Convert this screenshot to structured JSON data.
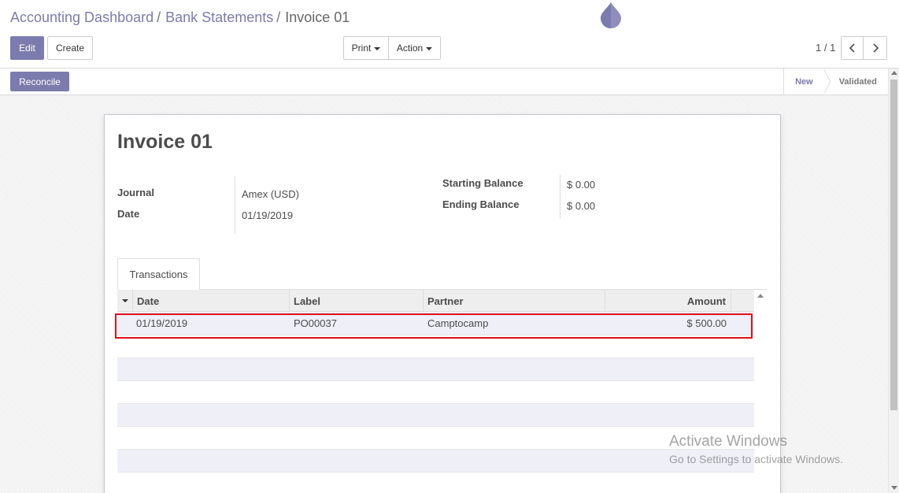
{
  "breadcrumb": {
    "items": [
      "Accounting Dashboard",
      "Bank Statements"
    ],
    "separator": "/",
    "current": "Invoice 01"
  },
  "toolbar": {
    "edit_label": "Edit",
    "create_label": "Create",
    "print_label": "Print",
    "action_label": "Action"
  },
  "pager": {
    "value": "1 / 1",
    "prev_icon": "chevron-left-icon",
    "next_icon": "chevron-right-icon"
  },
  "statusbar": {
    "reconcile_label": "Reconcile",
    "steps": [
      "New",
      "Validated"
    ],
    "active_step": "New"
  },
  "form": {
    "title": "Invoice 01",
    "journal_label": "Journal",
    "journal_value": "Amex (USD)",
    "date_label": "Date",
    "date_value": "01/19/2019",
    "starting_balance_label": "Starting Balance",
    "starting_balance_value": "$ 0.00",
    "ending_balance_label": "Ending Balance",
    "ending_balance_value": "$ 0.00"
  },
  "tabs": [
    {
      "label": "Transactions"
    }
  ],
  "transactions": {
    "columns": [
      "Date",
      "Label",
      "Partner",
      "Amount"
    ],
    "rows": [
      {
        "date": "01/19/2019",
        "label": "PO00037",
        "partner": "Camptocamp",
        "amount": "$ 500.00"
      }
    ]
  },
  "watermark": {
    "line1": "Activate Windows",
    "line2": "Go to Settings to activate Windows."
  },
  "colors": {
    "accent": "#7c7bad",
    "highlight": "#e0101a",
    "row_alt": "#eeeff7"
  }
}
